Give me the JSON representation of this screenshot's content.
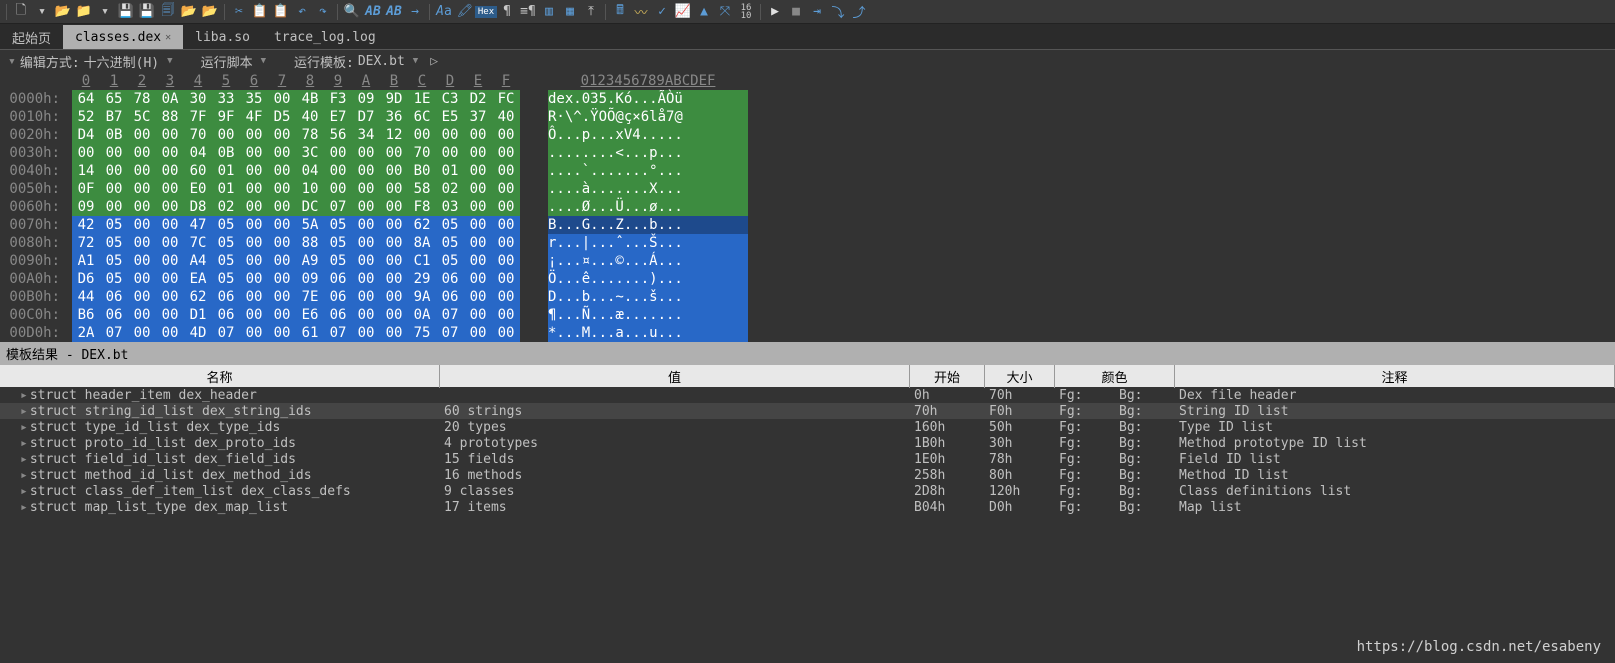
{
  "tabs": {
    "start": "起始页",
    "active": "classes.dex",
    "t2": "liba.so",
    "t3": "trace_log.log"
  },
  "infobar": {
    "edit_mode_label": "编辑方式:",
    "edit_mode_value": "十六进制(H)",
    "run_script_label": "运行脚本",
    "run_template_label": "运行模板:",
    "run_template_value": "DEX.bt"
  },
  "hex": {
    "offsets_header": [
      "0",
      "1",
      "2",
      "3",
      "4",
      "5",
      "6",
      "7",
      "8",
      "9",
      "A",
      "B",
      "C",
      "D",
      "E",
      "F"
    ],
    "ascii_header": "0123456789ABCDEF",
    "rows": [
      {
        "off": "0000h:",
        "b": [
          "64",
          "65",
          "78",
          "0A",
          "30",
          "33",
          "35",
          "00",
          "4B",
          "F3",
          "09",
          "9D",
          "1E",
          "C3",
          "D2",
          "FC"
        ],
        "a": "dex.035.Kó...ÃÒü",
        "cls": "bg-green"
      },
      {
        "off": "0010h:",
        "b": [
          "52",
          "B7",
          "5C",
          "88",
          "7F",
          "9F",
          "4F",
          "D5",
          "40",
          "E7",
          "D7",
          "36",
          "6C",
          "E5",
          "37",
          "40"
        ],
        "a": "R·\\^.ŸOÕ@ç×6lå7@",
        "cls": "bg-green"
      },
      {
        "off": "0020h:",
        "b": [
          "D4",
          "0B",
          "00",
          "00",
          "70",
          "00",
          "00",
          "00",
          "78",
          "56",
          "34",
          "12",
          "00",
          "00",
          "00",
          "00"
        ],
        "a": "Ô...p...xV4.....",
        "cls": "bg-green"
      },
      {
        "off": "0030h:",
        "b": [
          "00",
          "00",
          "00",
          "00",
          "04",
          "0B",
          "00",
          "00",
          "3C",
          "00",
          "00",
          "00",
          "70",
          "00",
          "00",
          "00"
        ],
        "a": "........<...p...",
        "cls": "bg-green"
      },
      {
        "off": "0040h:",
        "b": [
          "14",
          "00",
          "00",
          "00",
          "60",
          "01",
          "00",
          "00",
          "04",
          "00",
          "00",
          "00",
          "B0",
          "01",
          "00",
          "00"
        ],
        "a": "....`.......°...",
        "cls": "bg-green"
      },
      {
        "off": "0050h:",
        "b": [
          "0F",
          "00",
          "00",
          "00",
          "E0",
          "01",
          "00",
          "00",
          "10",
          "00",
          "00",
          "00",
          "58",
          "02",
          "00",
          "00"
        ],
        "a": "....à.......X...",
        "cls": "bg-green"
      },
      {
        "off": "0060h:",
        "b": [
          "09",
          "00",
          "00",
          "00",
          "D8",
          "02",
          "00",
          "00",
          "DC",
          "07",
          "00",
          "00",
          "F8",
          "03",
          "00",
          "00"
        ],
        "a": "....Ø...Ü...ø...",
        "cls": "bg-green"
      },
      {
        "off": "0070h:",
        "b": [
          "42",
          "05",
          "00",
          "00",
          "47",
          "05",
          "00",
          "00",
          "5A",
          "05",
          "00",
          "00",
          "62",
          "05",
          "00",
          "00"
        ],
        "a": "B...G...Z...b...",
        "cls": "bg-blue"
      },
      {
        "off": "0080h:",
        "b": [
          "72",
          "05",
          "00",
          "00",
          "7C",
          "05",
          "00",
          "00",
          "88",
          "05",
          "00",
          "00",
          "8A",
          "05",
          "00",
          "00"
        ],
        "a": "r...|...ˆ...Š...",
        "cls": "bg-blue"
      },
      {
        "off": "0090h:",
        "b": [
          "A1",
          "05",
          "00",
          "00",
          "A4",
          "05",
          "00",
          "00",
          "A9",
          "05",
          "00",
          "00",
          "C1",
          "05",
          "00",
          "00"
        ],
        "a": "¡...¤...©...Á...",
        "cls": "bg-blue"
      },
      {
        "off": "00A0h:",
        "b": [
          "D6",
          "05",
          "00",
          "00",
          "EA",
          "05",
          "00",
          "00",
          "09",
          "06",
          "00",
          "00",
          "29",
          "06",
          "00",
          "00"
        ],
        "a": "Ö...ê.......)...",
        "cls": "bg-blue"
      },
      {
        "off": "00B0h:",
        "b": [
          "44",
          "06",
          "00",
          "00",
          "62",
          "06",
          "00",
          "00",
          "7E",
          "06",
          "00",
          "00",
          "9A",
          "06",
          "00",
          "00"
        ],
        "a": "D...b...~...š...",
        "cls": "bg-blue"
      },
      {
        "off": "00C0h:",
        "b": [
          "B6",
          "06",
          "00",
          "00",
          "D1",
          "06",
          "00",
          "00",
          "E6",
          "06",
          "00",
          "00",
          "0A",
          "07",
          "00",
          "00"
        ],
        "a": "¶...Ñ...æ.......",
        "cls": "bg-blue"
      },
      {
        "off": "00D0h:",
        "b": [
          "2A",
          "07",
          "00",
          "00",
          "4D",
          "07",
          "00",
          "00",
          "61",
          "07",
          "00",
          "00",
          "75",
          "07",
          "00",
          "00"
        ],
        "a": "*...M...a...u...",
        "cls": "bg-blue"
      }
    ]
  },
  "template": {
    "title": "模板结果 - DEX.bt",
    "headers": {
      "name": "名称",
      "value": "值",
      "start": "开始",
      "size": "大小",
      "color": "颜色",
      "comment": "注释"
    },
    "fg": "Fg:",
    "bg": "Bg:",
    "rows": [
      {
        "name": "struct header_item dex_header",
        "value": "",
        "start": "0h",
        "size": "70h",
        "comment": "Dex file header"
      },
      {
        "name": "struct string_id_list dex_string_ids",
        "value": "60 strings",
        "start": "70h",
        "size": "F0h",
        "comment": "String ID list",
        "sel": true
      },
      {
        "name": "struct type_id_list dex_type_ids",
        "value": "20 types",
        "start": "160h",
        "size": "50h",
        "comment": "Type ID list"
      },
      {
        "name": "struct proto_id_list dex_proto_ids",
        "value": "4 prototypes",
        "start": "1B0h",
        "size": "30h",
        "comment": "Method prototype ID list"
      },
      {
        "name": "struct field_id_list dex_field_ids",
        "value": "15 fields",
        "start": "1E0h",
        "size": "78h",
        "comment": "Field ID list"
      },
      {
        "name": "struct method_id_list dex_method_ids",
        "value": "16 methods",
        "start": "258h",
        "size": "80h",
        "comment": "Method ID list"
      },
      {
        "name": "struct class_def_item_list dex_class_defs",
        "value": "9 classes",
        "start": "2D8h",
        "size": "120h",
        "comment": "Class definitions list"
      },
      {
        "name": "struct map_list_type dex_map_list",
        "value": "17 items",
        "start": "B04h",
        "size": "D0h",
        "comment": "Map list"
      }
    ]
  },
  "watermark": "https://blog.csdn.net/esabeny"
}
